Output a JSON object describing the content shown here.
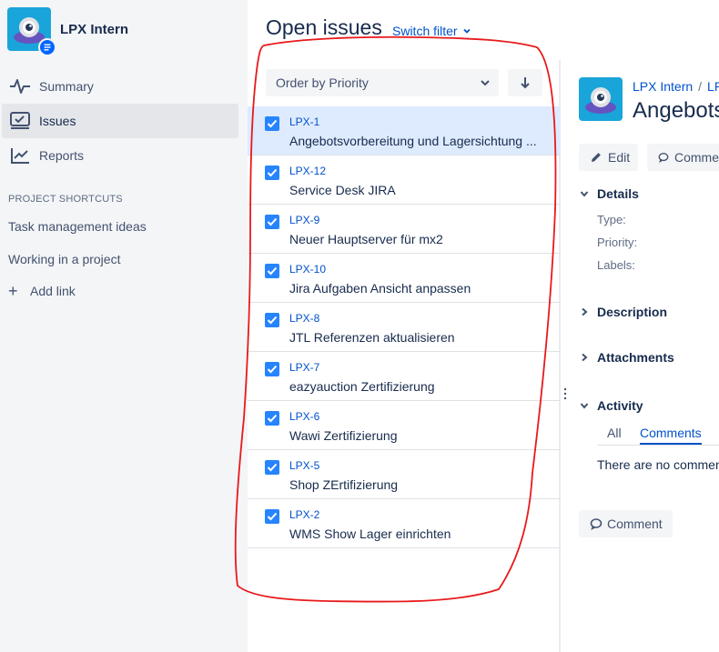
{
  "sidebar": {
    "project_name": "LPX Intern",
    "nav": [
      {
        "label": "Summary",
        "icon": "summary-pulse-icon"
      },
      {
        "label": "Issues",
        "icon": "issues-board-icon",
        "active": true
      },
      {
        "label": "Reports",
        "icon": "reports-chart-icon"
      }
    ],
    "shortcuts_title": "PROJECT SHORTCUTS",
    "shortcuts": [
      "Task management ideas",
      "Working in a project"
    ],
    "add_link": "Add link"
  },
  "header": {
    "title": "Open issues",
    "switch_filter": "Switch filter"
  },
  "list": {
    "order_label": "Order by Priority",
    "sort_icon": "arrow-down-icon",
    "issues": [
      {
        "key": "LPX-1",
        "summary": "Angebotsvorbereitung und Lagersichtung ...",
        "selected": true
      },
      {
        "key": "LPX-12",
        "summary": "Service Desk JIRA"
      },
      {
        "key": "LPX-9",
        "summary": "Neuer Hauptserver für mx2"
      },
      {
        "key": "LPX-10",
        "summary": "Jira Aufgaben Ansicht anpassen"
      },
      {
        "key": "LPX-8",
        "summary": "JTL Referenzen aktualisieren"
      },
      {
        "key": "LPX-7",
        "summary": "eazyauction Zertifizierung"
      },
      {
        "key": "LPX-6",
        "summary": "Wawi Zertifizierung"
      },
      {
        "key": "LPX-5",
        "summary": "Shop ZErtifizierung"
      },
      {
        "key": "LPX-2",
        "summary": "WMS Show Lager einrichten"
      }
    ]
  },
  "detail": {
    "breadcrumb": [
      "LPX Intern",
      "LP"
    ],
    "title": "Angebots",
    "edit_label": "Edit",
    "comment_label": "Comme",
    "sections": {
      "details": "Details",
      "description": "Description",
      "attachments": "Attachments",
      "activity": "Activity"
    },
    "fields": [
      "Type:",
      "Priority:",
      "Labels:"
    ],
    "tabs": {
      "all": "All",
      "comments": "Comments"
    },
    "no_comments": "There are no commen",
    "comment_button": "Comment"
  },
  "colors": {
    "accent": "#0052cc",
    "checkbox": "#2684ff",
    "selected_row": "#deebff",
    "annotation": "#e8191b"
  }
}
